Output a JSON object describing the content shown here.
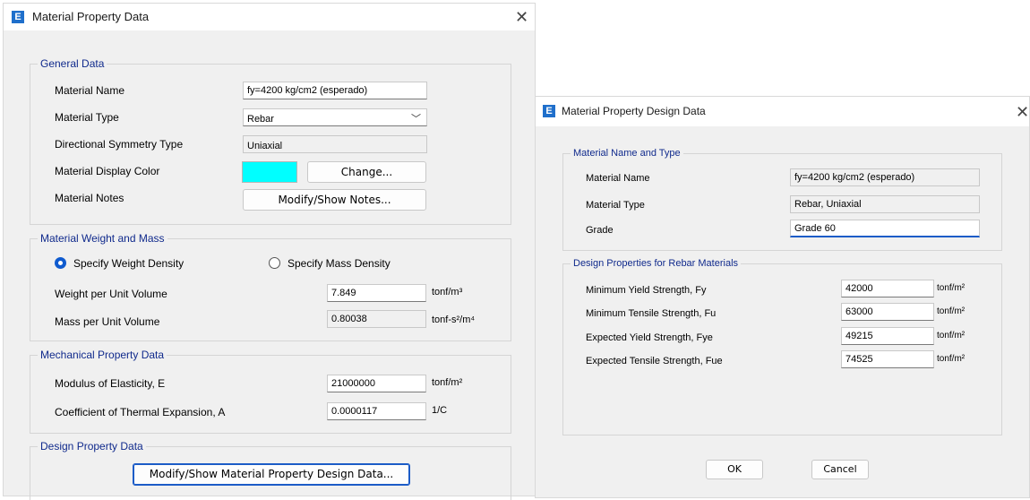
{
  "dialog1": {
    "title": "Material Property Data",
    "icon_letter": "E",
    "general": {
      "legend": "General Data",
      "material_name_label": "Material Name",
      "material_name_value": "fy=4200 kg/cm2 (esperado)",
      "material_type_label": "Material Type",
      "material_type_value": "Rebar",
      "symmetry_label": "Directional Symmetry Type",
      "symmetry_value": "Uniaxial",
      "display_color_label": "Material Display Color",
      "display_color": "#00FFFF",
      "change_button": "Change...",
      "notes_label": "Material Notes",
      "notes_button": "Modify/Show Notes..."
    },
    "weight": {
      "legend": "Material Weight and Mass",
      "weight_option": "Specify Weight Density",
      "mass_option": "Specify Mass Density",
      "weight_label": "Weight per Unit Volume",
      "weight_value": "7.849",
      "weight_unit": "tonf/m³",
      "mass_label": "Mass per Unit Volume",
      "mass_value": "0.80038",
      "mass_unit": "tonf-s²/m⁴"
    },
    "mechanical": {
      "legend": "Mechanical Property Data",
      "modulus_label": "Modulus of Elasticity,  E",
      "modulus_value": "21000000",
      "modulus_unit": "tonf/m²",
      "thermal_label": "Coefficient of Thermal Expansion,  A",
      "thermal_value": "0.0000117",
      "thermal_unit": "1/C"
    },
    "design": {
      "legend": "Design Property Data",
      "button": "Modify/Show Material Property Design Data..."
    }
  },
  "dialog2": {
    "title": "Material Property Design Data",
    "icon_letter": "E",
    "name_type": {
      "legend": "Material Name and Type",
      "name_label": "Material Name",
      "name_value": "fy=4200 kg/cm2 (esperado)",
      "type_label": "Material Type",
      "type_value": "Rebar, Uniaxial",
      "grade_label": "Grade",
      "grade_value": "Grade 60"
    },
    "design": {
      "legend": "Design Properties for Rebar Materials",
      "fy_label": "Minimum Yield Strength, Fy",
      "fy_value": "42000",
      "fu_label": "Minimum Tensile Strength, Fu",
      "fu_value": "63000",
      "fye_label": "Expected Yield Strength, Fye",
      "fye_value": "49215",
      "fue_label": "Expected Tensile Strength, Fue",
      "fue_value": "74525",
      "unit": "tonf/m²"
    },
    "ok_button": "OK",
    "cancel_button": "Cancel"
  }
}
